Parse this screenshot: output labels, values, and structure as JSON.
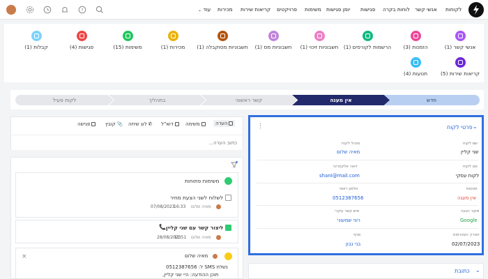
{
  "topnav": {
    "links": [
      "לקוחות",
      "אנשי קשר",
      "לוחות בקרה",
      "פגישות",
      "יומן פגישות",
      "משימות",
      "פרויקטים",
      "קריאות שירות",
      "מכירות",
      "עוד"
    ]
  },
  "tiles": [
    {
      "label": "אנשי קשר (1)",
      "color": "#a855f7"
    },
    {
      "label": "הזמנות (3)",
      "color": "#ec4899"
    },
    {
      "label": "הרשמות לקורסים (1)",
      "color": "#10b981"
    },
    {
      "label": "חשבוניות זיכוי (1)",
      "color": "#ec7fc4"
    },
    {
      "label": "חשבוניות מס (1)",
      "color": "#c084d8"
    },
    {
      "label": "חשבוניות מסוקבלה (1)",
      "color": "#b45309"
    },
    {
      "label": "מכירות (1)",
      "color": "#eab308"
    },
    {
      "label": "משימות (15)",
      "color": "#22c55e"
    },
    {
      "label": "פגישות (4)",
      "color": "#ef4444"
    },
    {
      "label": "קבלות (1)",
      "color": "#7dd3fc"
    },
    {
      "label": "קריאות שירות (5)",
      "color": "#6d28d9"
    },
    {
      "label": "תנועות (4)",
      "color": "#38bdf8"
    }
  ],
  "stages": [
    "חדש",
    "אין מענה",
    "קשר ראשוני",
    "בתהליך",
    "לקוח פעיל"
  ],
  "notes": {
    "tabs": [
      "הערה",
      "משימה",
      "דוא\"ל",
      "לוג שיחה",
      "קובץ",
      "פגישה"
    ],
    "placeholder": "כתוב הערה..."
  },
  "activity": {
    "card1": {
      "title": "משימות פתוחות",
      "task": "לשלוח לשני הצעת מחיר",
      "user": "מאיה שלום",
      "time": "16:33",
      "date": "07/08/2023"
    },
    "card2": {
      "title": "ליצור קשר עם שני קליין",
      "user": "מאיה שלום",
      "time": "11:51",
      "date": "28/08/2023"
    },
    "card3": {
      "user": "מאיה שלום",
      "line1": "נשלח SMS ל: 0512387656",
      "line2": "תוכן ההודעה: היי  שני קליין,"
    }
  },
  "details": {
    "title": "פרטי לקוח",
    "fields": {
      "name_label": "שם לקוח",
      "name_value": "שני קליין",
      "manager_label": "מנהל לקוח",
      "manager_value": "מאיה שלום",
      "type_label": "סוג לקוח",
      "type_value": "לקוח עסקי",
      "email_label": "דואר אלקטרוני",
      "email_value": "shani@mail.com",
      "status_label": "סטטוס",
      "status_value": "אין מענה",
      "phone_label": "טלפון ראשי",
      "phone_value": "0512387656",
      "source_label": "מקור הגעה",
      "source_value": "Google",
      "contact_label": "איש קשר עיקרי",
      "contact_value": "רוני שמעוני",
      "created_label": "תאריך הצטרפות",
      "created_value": "02/07/2023",
      "branch_label": "סניף",
      "branch_value": "בני נבון"
    }
  },
  "address": {
    "title": "כתובת"
  },
  "colors": {
    "accent": "#2f6fe0",
    "stage_active": "#232a6b",
    "stage_new": "#b9cff2",
    "status_green": "#22a34a",
    "link": "#1d5fd6"
  }
}
